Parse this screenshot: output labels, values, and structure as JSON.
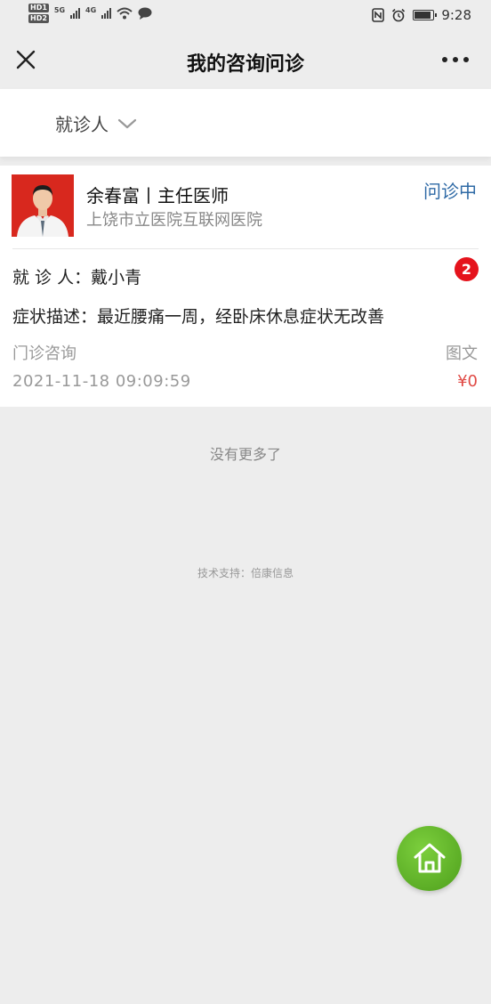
{
  "status_bar": {
    "sim1": "HD1",
    "sim2": "HD2",
    "net1": "5G",
    "net2": "4G",
    "time": "9:28",
    "icons": [
      "signal-icon",
      "wifi-icon",
      "message-icon",
      "nfc-icon",
      "alarm-icon",
      "battery-icon"
    ]
  },
  "header": {
    "title": "我的咨询问诊",
    "close_icon": "close-icon",
    "more_icon": "more-icon"
  },
  "filter": {
    "label": "就诊人",
    "icon": "chevron-down-icon"
  },
  "consultation": {
    "doctor_name": "余春富丨主任医师",
    "hospital": "上饶市立医院互联网医院",
    "status": "问诊中",
    "unread_count": "2",
    "patient_row": "就 诊 人：戴小青",
    "symptom_row": "症状描述：最近腰痛一周，经卧床休息症状无改善",
    "type": "门诊咨询",
    "mode": "图文",
    "time": "2021-11-18 09:09:59",
    "price": "¥0"
  },
  "footer": {
    "no_more": "没有更多了",
    "tech_support": "技术支持：倍康信息"
  },
  "colors": {
    "accent_blue": "#2f6aa6",
    "badge_red": "#e5131c",
    "price_red": "#e04a45",
    "fab_green": "#5bb226",
    "avatar_bg": "#d8281e"
  }
}
